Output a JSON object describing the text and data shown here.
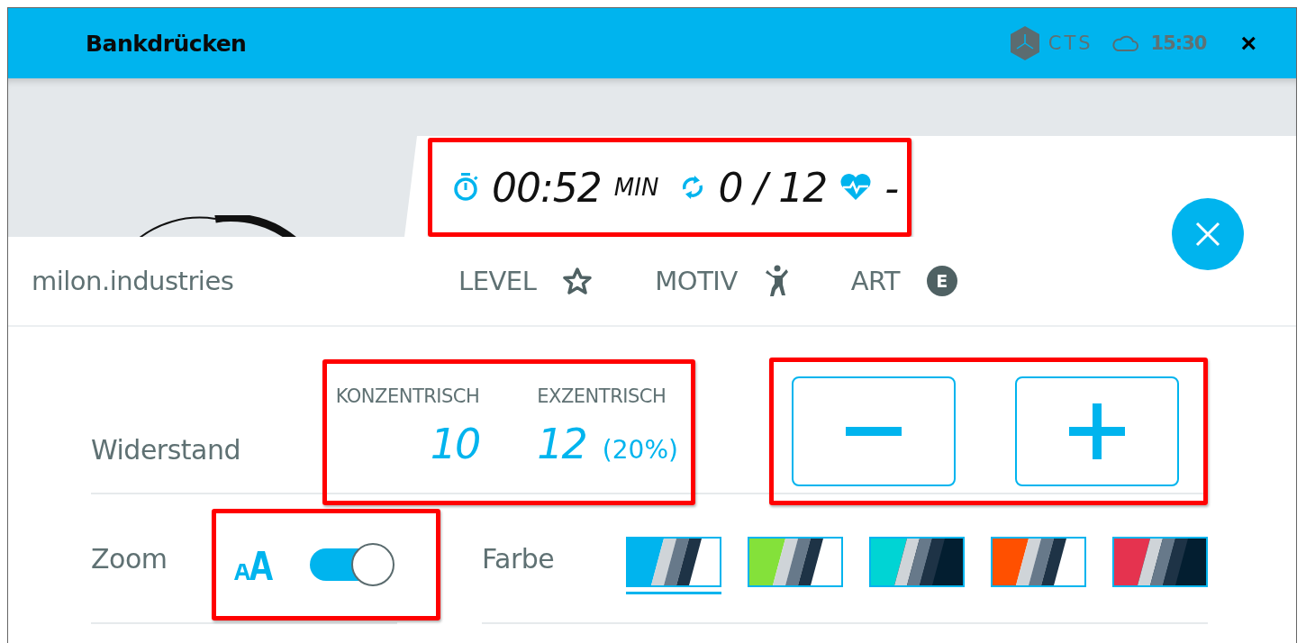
{
  "window": {
    "title": "Bankdrücken",
    "brand": "CTS",
    "time": "15:30",
    "close": "×"
  },
  "stats": {
    "highlighted": true,
    "duration": "00:52",
    "duration_unit": "MIN",
    "reps": "0 / 12",
    "heart_rate": "-"
  },
  "panel": {
    "brand": "milon.industries",
    "tabs": [
      {
        "label": "LEVEL",
        "kind": "star"
      },
      {
        "label": "MOTIV",
        "kind": "figure"
      },
      {
        "label": "ART",
        "kind": "badge",
        "badge": "E"
      }
    ]
  },
  "resistance": {
    "label": "Widerstand",
    "highlighted": true,
    "concentric": {
      "label": "KONZENTRISCH",
      "value": "10"
    },
    "eccentric": {
      "label": "EXZENTRISCH",
      "value": "12",
      "percent": "(20%)"
    },
    "controls_highlighted": true,
    "buttons": [
      {
        "kind": "minus"
      },
      {
        "kind": "plus"
      }
    ]
  },
  "zoom": {
    "label": "Zoom",
    "on": true,
    "highlighted": true
  },
  "color": {
    "label": "Farbe",
    "swatches": [
      {
        "color": "#00b4ee",
        "kind": "light",
        "selected": true
      },
      {
        "color": "#84e13a",
        "kind": "light",
        "selected": false
      },
      {
        "color": "#00d4d4",
        "kind": "dark",
        "selected": false
      },
      {
        "color": "#ff5000",
        "kind": "light",
        "selected": false
      },
      {
        "color": "#e5334f",
        "kind": "dark",
        "selected": false
      }
    ]
  }
}
